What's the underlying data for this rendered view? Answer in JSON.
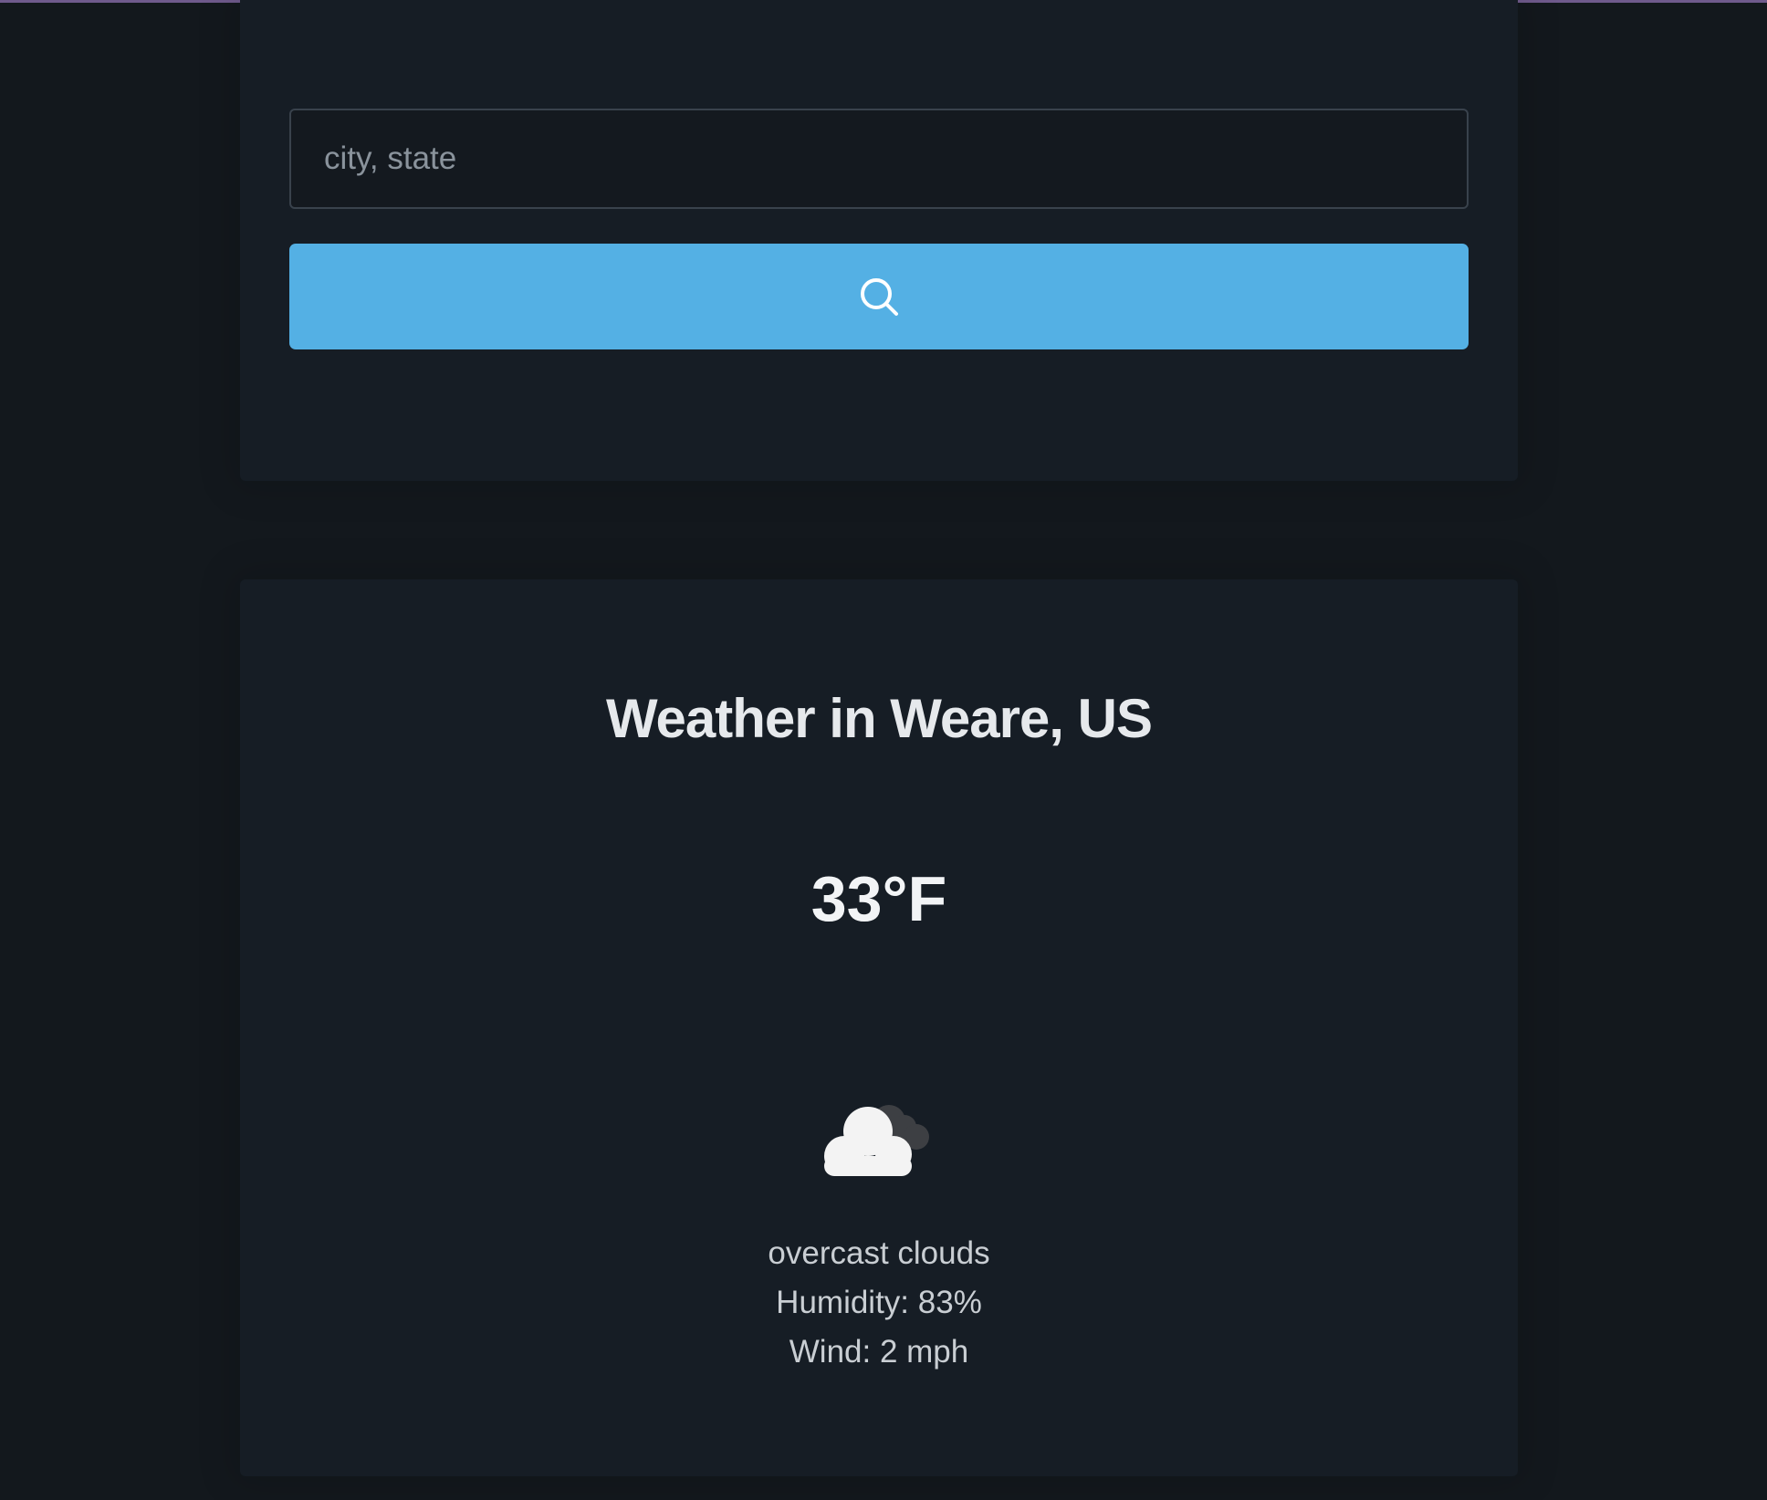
{
  "search": {
    "placeholder": "city, state",
    "value": "",
    "button_icon": "search-icon"
  },
  "weather": {
    "title": "Weather in Weare, US",
    "temperature": "33°F",
    "icon": "overcast-clouds-icon",
    "description": "overcast clouds",
    "humidity": "Humidity: 83%",
    "wind": "Wind: 2 mph"
  },
  "colors": {
    "background": "#13181d",
    "card": "#161d25",
    "accent": "#54b0e4",
    "top_bar": "#6f5a8c"
  }
}
